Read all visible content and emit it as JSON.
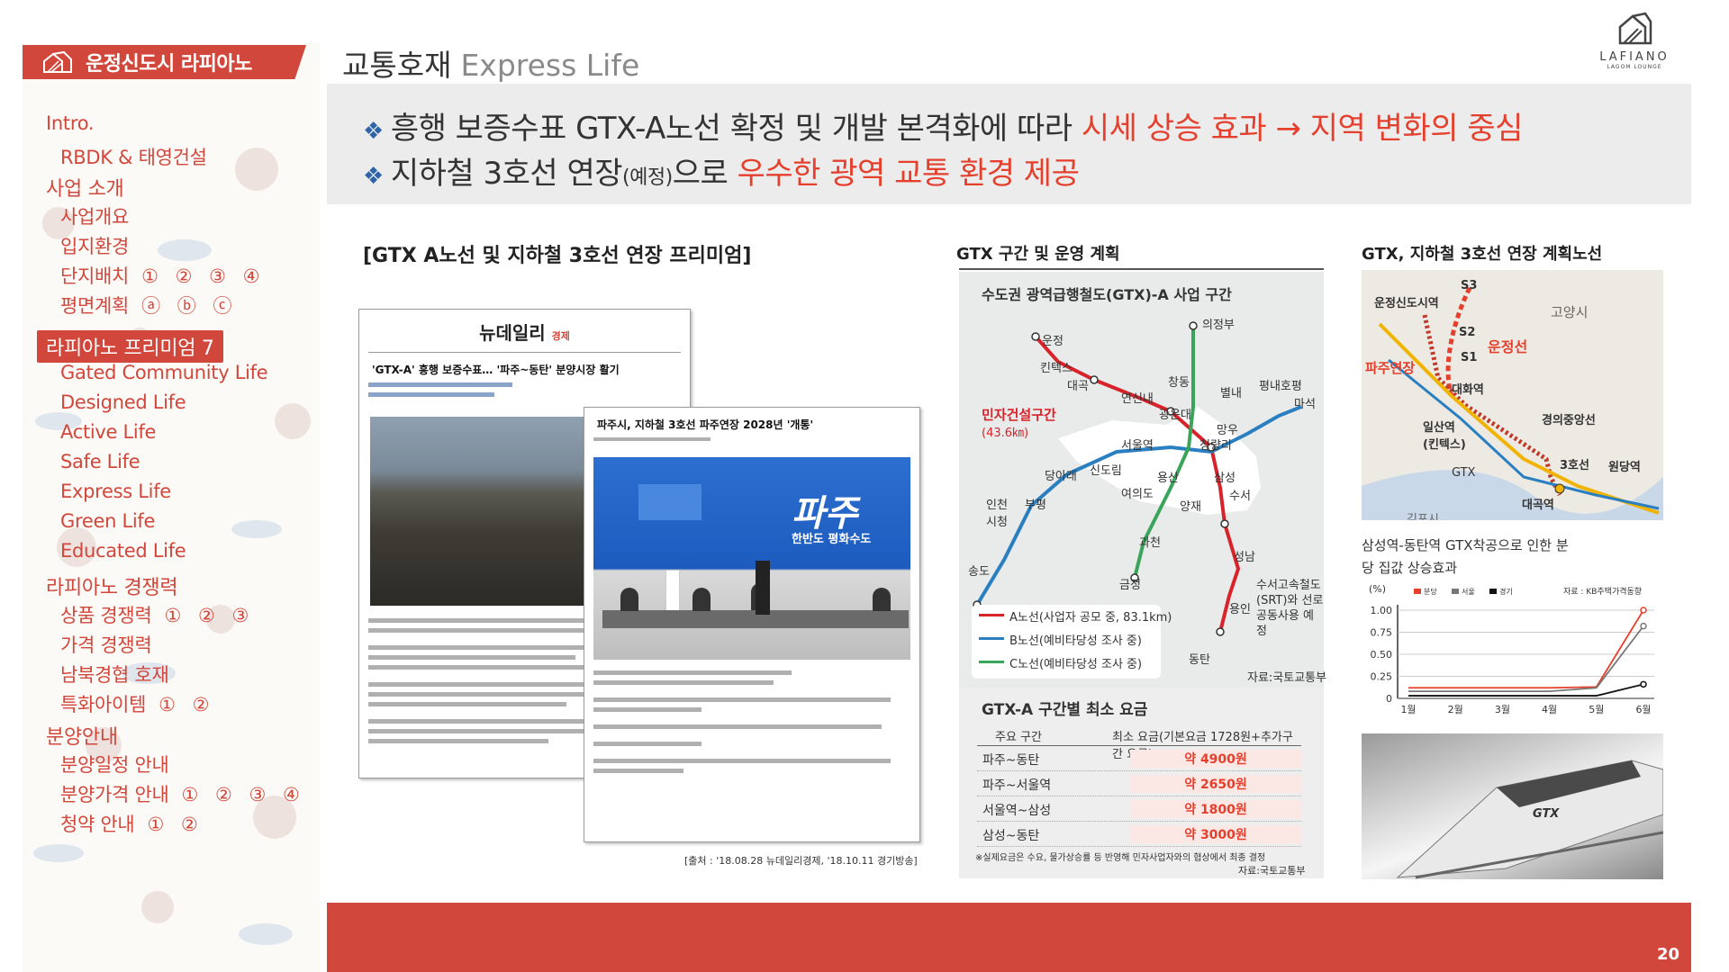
{
  "sidebar": {
    "brand": "운정신도시 라피아노",
    "items": [
      {
        "label": "Intro."
      },
      {
        "label": "RBDK & 태영건설"
      },
      {
        "label": "사업 소개"
      },
      {
        "label": "사업개요"
      },
      {
        "label": "입지환경"
      },
      {
        "label": "단지배치",
        "marks": "① ② ③ ④"
      },
      {
        "label": "평면계획",
        "marks": "ⓐ ⓑ ⓒ"
      },
      {
        "label": "라피아노 프리미엄 7"
      },
      {
        "label": "Gated Community Life"
      },
      {
        "label": "Designed Life"
      },
      {
        "label": "Active Life"
      },
      {
        "label": "Safe Life"
      },
      {
        "label": "Express Life"
      },
      {
        "label": "Green Life"
      },
      {
        "label": "Educated Life"
      },
      {
        "label": "라피아노 경쟁력"
      },
      {
        "label": "상품 경쟁력",
        "marks": "① ② ③"
      },
      {
        "label": "가격 경쟁력"
      },
      {
        "label": "남북경협 호재"
      },
      {
        "label": "특화아이템",
        "marks": "① ②"
      },
      {
        "label": "분양안내"
      },
      {
        "label": "분양일정 안내"
      },
      {
        "label": "분양가격 안내",
        "marks": "① ② ③ ④"
      },
      {
        "label": "청약 안내",
        "marks": "① ②"
      }
    ]
  },
  "header": {
    "title_ko": "교통호재",
    "title_en": "Express Life",
    "logo_text": "LAFIANO",
    "logo_sub": "LAGOM LOUNGE"
  },
  "banner": {
    "line1_text": "흥행 보증수표 GTX-A노선 확정 및 개발 본격화에 따라 ",
    "line1_highlight": "시세 상승 효과 → 지역 변화의 중심",
    "line2_text": "지하철 3호선 연장",
    "line2_small": "(예정)",
    "line2_text2": "으로 ",
    "line2_highlight": "우수한 광역 교통 환경 제공"
  },
  "left_section": {
    "title": "[GTX A노선 및 지하철 3호선 연장 프리미엄]",
    "paper1": {
      "masthead": "뉴데일리",
      "masthead_sub": "경제",
      "headline": "'GTX-A' 흥행 보증수표… '파주~동탄' 분양시장 활기"
    },
    "paper2": {
      "headline": "파주시, 지하철 3호선 파주연장 2028년 '개통'",
      "slide_text": "한반도 평화수도",
      "slide_brand": "파주"
    },
    "source": "[출처 : '18.08.28 뉴데일리경제, '18.10.11 경기방송]"
  },
  "middle_section": {
    "title": "GTX 구간 및 운영 계획",
    "map_title": "수도권 광역급행철도(GTX)-A 사업 구간",
    "map_private": "민자건설구간",
    "map_private_len": "(43.6㎞)",
    "stations": [
      "운정",
      "킨텍스",
      "대곡",
      "연신내",
      "서울역",
      "삼성",
      "수서",
      "성남",
      "용인",
      "동탄",
      "의정부",
      "창동",
      "광운대",
      "청량리",
      "망우",
      "별내",
      "평내호평",
      "마석",
      "당아래",
      "신도림",
      "용산",
      "여의도",
      "인천시청",
      "부평",
      "양재",
      "과천",
      "금정",
      "송도"
    ],
    "legend": [
      {
        "label": "A노선(사업자 공모 중, 83.1km)",
        "color": "#d8232a"
      },
      {
        "label": "B노선(예비타당성 조사 중)",
        "color": "#2a7fc1"
      },
      {
        "label": "C노선(예비타당성 조사 중)",
        "color": "#3aa55a"
      }
    ],
    "srt_note": "수서고속철도 (SRT)와 선로 공동사용 예정",
    "map_source": "자료:국토교통부",
    "fare_title": "GTX-A 구간별 최소 요금",
    "fare_headers": [
      "주요 구간",
      "최소 요금(기본요금 1728원+추가구간 요금)"
    ],
    "fares": [
      {
        "route": "파주~동탄",
        "fare": "약 4900원"
      },
      {
        "route": "파주~서울역",
        "fare": "약 2650원"
      },
      {
        "route": "서울역~삼성",
        "fare": "약 1800원"
      },
      {
        "route": "삼성~동탄",
        "fare": "약 3000원"
      }
    ],
    "fare_note": "※실제요금은 수요, 물가상승률 등 반영해 민자사업자와의 협상에서 최종 결정",
    "fare_source": "자료:국토교통부"
  },
  "right_section": {
    "title": "GTX, 지하철 3호선 연장 계획노선",
    "map_labels": [
      "운정신도시역",
      "S3",
      "S2",
      "S1",
      "운정선",
      "고양시",
      "파주연장",
      "대화역",
      "일산역 (킨텍스)",
      "경의중앙선",
      "GTX",
      "3호선",
      "원당역",
      "대곡역",
      "김포시"
    ],
    "chart_title": "삼성역-동탄역 GTX착공으로 인한 분당 집값 상승효과",
    "photo_caption": "GTX"
  },
  "chart_data": {
    "type": "line",
    "title": "삼성역-동탄역 GTX착공으로 인한 분당 집값 상승효과",
    "ylabel": "(%)",
    "source": "자료 : KB주택가격동향",
    "categories": [
      "1월",
      "2월",
      "3월",
      "4월",
      "5월",
      "6월"
    ],
    "yticks": [
      "1.00",
      "0.75",
      "0.50",
      "0.25",
      "0"
    ],
    "ylim": [
      0,
      1.0
    ],
    "legend_position": "top",
    "series": [
      {
        "name": "분당",
        "color": "#e5402e",
        "values": [
          0.12,
          0.12,
          0.12,
          0.12,
          0.13,
          1.0
        ]
      },
      {
        "name": "서울",
        "color": "#777777",
        "values": [
          0.08,
          0.08,
          0.08,
          0.08,
          0.12,
          0.82
        ]
      },
      {
        "name": "경기",
        "color": "#111111",
        "values": [
          0.03,
          0.03,
          0.03,
          0.03,
          0.03,
          0.16
        ]
      }
    ]
  },
  "footer": {
    "page_number": "20"
  }
}
